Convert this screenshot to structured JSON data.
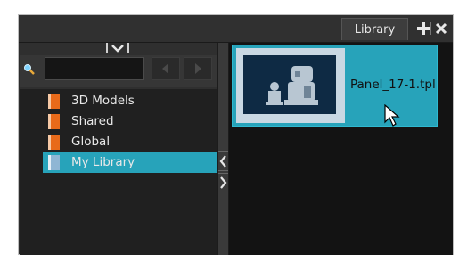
{
  "window": {
    "tab_label": "Library",
    "icons": {
      "add": "plus-icon",
      "close": "close-icon",
      "collapse": "chevron-down-icon"
    }
  },
  "left_panel": {
    "search": {
      "value": "",
      "placeholder": ""
    },
    "tree_items": [
      {
        "label": "3D Models",
        "icon": "library-book-icon",
        "selected": false
      },
      {
        "label": "Shared",
        "icon": "library-book-icon",
        "selected": false
      },
      {
        "label": "Global",
        "icon": "library-book-icon",
        "selected": false
      },
      {
        "label": "My Library",
        "icon": "library-book-icon",
        "selected": true
      }
    ]
  },
  "right_panel": {
    "items": [
      {
        "name": "Panel_17-1.tpl",
        "selected": true
      }
    ]
  },
  "colors": {
    "selection": "#27a3ba",
    "book_icon": "#e86a1a",
    "book_icon_selected": "#8fb6d4"
  }
}
